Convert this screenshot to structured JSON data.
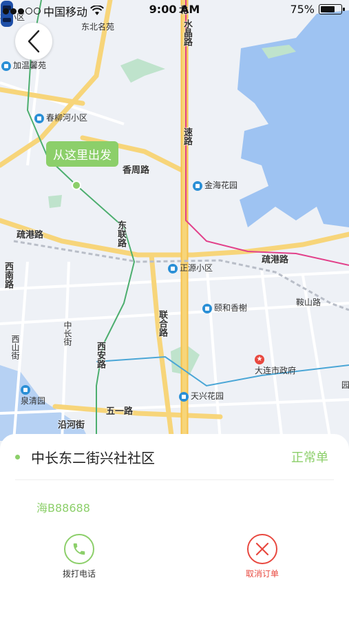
{
  "status_bar": {
    "carrier": "中国移动",
    "time": "9:00 AM",
    "battery": "75%",
    "battery_level": 0.75
  },
  "map": {
    "start_bubble": "从这里出发",
    "labels": {
      "dongbei": "东北名苑",
      "jiawen": "加温馨苑",
      "qiaoxiao": "桥小区",
      "chunliuhe": "春柳河小区",
      "xiangzhou": "香周路",
      "jinhai": "金海花园",
      "shugang1": "疏港路",
      "shugang2": "疏港路",
      "zhengyuan": "正源小区",
      "yihe": "颐和香榭",
      "xinan_nan": "西南路",
      "lianhe": "联合路",
      "xian": "西安路",
      "zhongchang": "中长街",
      "xishan": "西山街",
      "dalian": "大连市政府",
      "tianxing": "天兴花园",
      "quanqing": "泉清园",
      "wuyi": "五一路",
      "yanhe": "沿河街",
      "anshan": "鞍山路",
      "dongfa": "东联路",
      "sucheng": "速路",
      "bei": "北",
      "shuijing": "水晶路",
      "yuan": "园"
    }
  },
  "trip": {
    "address": "中长东二街兴社社区",
    "order_type": "正常单",
    "plate": "海B88688",
    "call_label": "拨打电话",
    "cancel_label": "取消订单"
  },
  "colors": {
    "accent_green": "#8ccf6a",
    "danger_red": "#e8483f",
    "water": "#9ec3f2",
    "road_major": "#f7d57a"
  }
}
